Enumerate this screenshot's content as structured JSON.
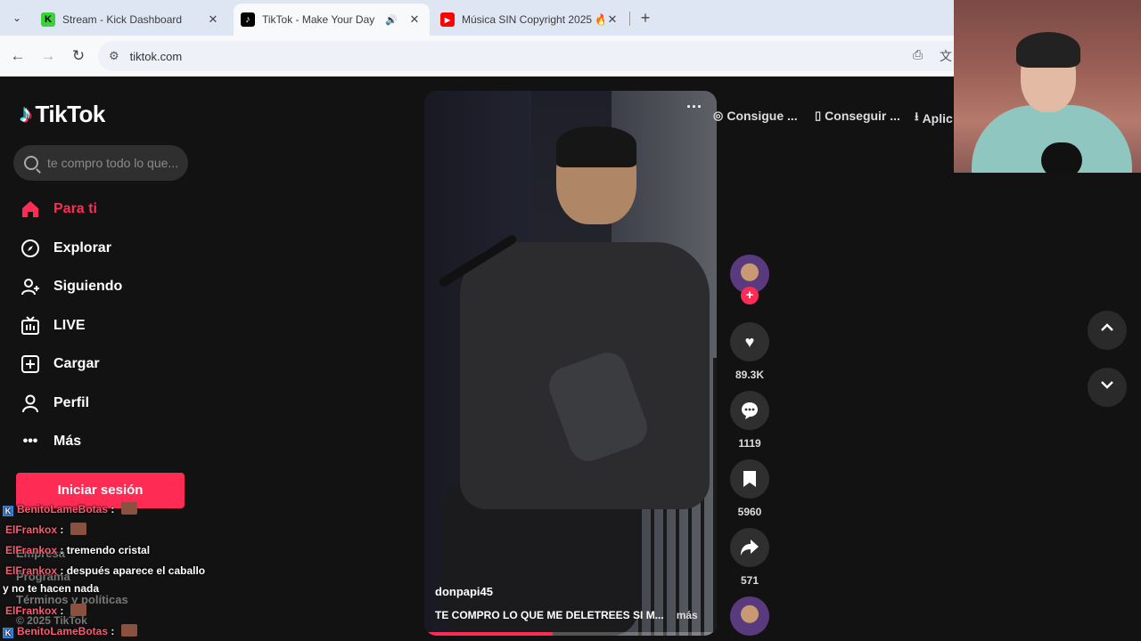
{
  "browser": {
    "tabs": [
      {
        "title": "Stream - Kick Dashboard",
        "favicon": "K",
        "active": false
      },
      {
        "title": "TikTok - Make Your Day",
        "favicon": "♪",
        "active": true,
        "audio": true
      },
      {
        "title": "Música SIN Copyright 2025 🔥",
        "favicon": "▶",
        "active": false
      }
    ],
    "new_tab_label": "+",
    "url": "tiktok.com"
  },
  "sidebar": {
    "logo_text": "TikTok",
    "search_placeholder": "te compro todo lo que...",
    "nav": [
      {
        "label": "Para ti",
        "icon": "home-icon",
        "active": true
      },
      {
        "label": "Explorar",
        "icon": "compass-icon"
      },
      {
        "label": "Siguiendo",
        "icon": "following-icon"
      },
      {
        "label": "LIVE",
        "icon": "live-icon"
      },
      {
        "label": "Cargar",
        "icon": "upload-icon"
      },
      {
        "label": "Perfil",
        "icon": "profile-icon"
      },
      {
        "label": "Más",
        "icon": "more-icon"
      }
    ],
    "login_label": "Iniciar sesión",
    "footer": [
      "Empresa",
      "Programa",
      "Términos y políticas",
      "© 2025 TikTok"
    ]
  },
  "get_app": [
    {
      "label": "Consigue ...",
      "icon": "coin-icon"
    },
    {
      "label": "Conseguir ...",
      "icon": "phone-icon"
    },
    {
      "label": "Aplic",
      "icon": "download-icon"
    }
  ],
  "video": {
    "author": "donpapi45",
    "description": "TE COMPRO LO QUE ME DELETREES SI M...",
    "more_label": "más",
    "progress": 0.44
  },
  "actions": {
    "likes": "89.3K",
    "comments": "1119",
    "saves": "5960",
    "shares": "571"
  },
  "chat": [
    {
      "user": "BenitoLameBotas",
      "text": "",
      "emote": true,
      "kick": true
    },
    {
      "user": "ElFrankox",
      "text": "",
      "emote": true
    },
    {
      "user": "ElFrankox",
      "text": "tremendo cristal"
    },
    {
      "user": "ElFrankox",
      "text": "después aparece el caballo"
    },
    {
      "user": "",
      "text": "y no te hacen nada"
    },
    {
      "user": "ElFrankox",
      "text": "",
      "emote": true
    },
    {
      "user": "BenitoLameBotas",
      "text": "",
      "emote": true,
      "kick": true
    }
  ],
  "colors": {
    "accent": "#fe2c55",
    "background": "#121212"
  }
}
